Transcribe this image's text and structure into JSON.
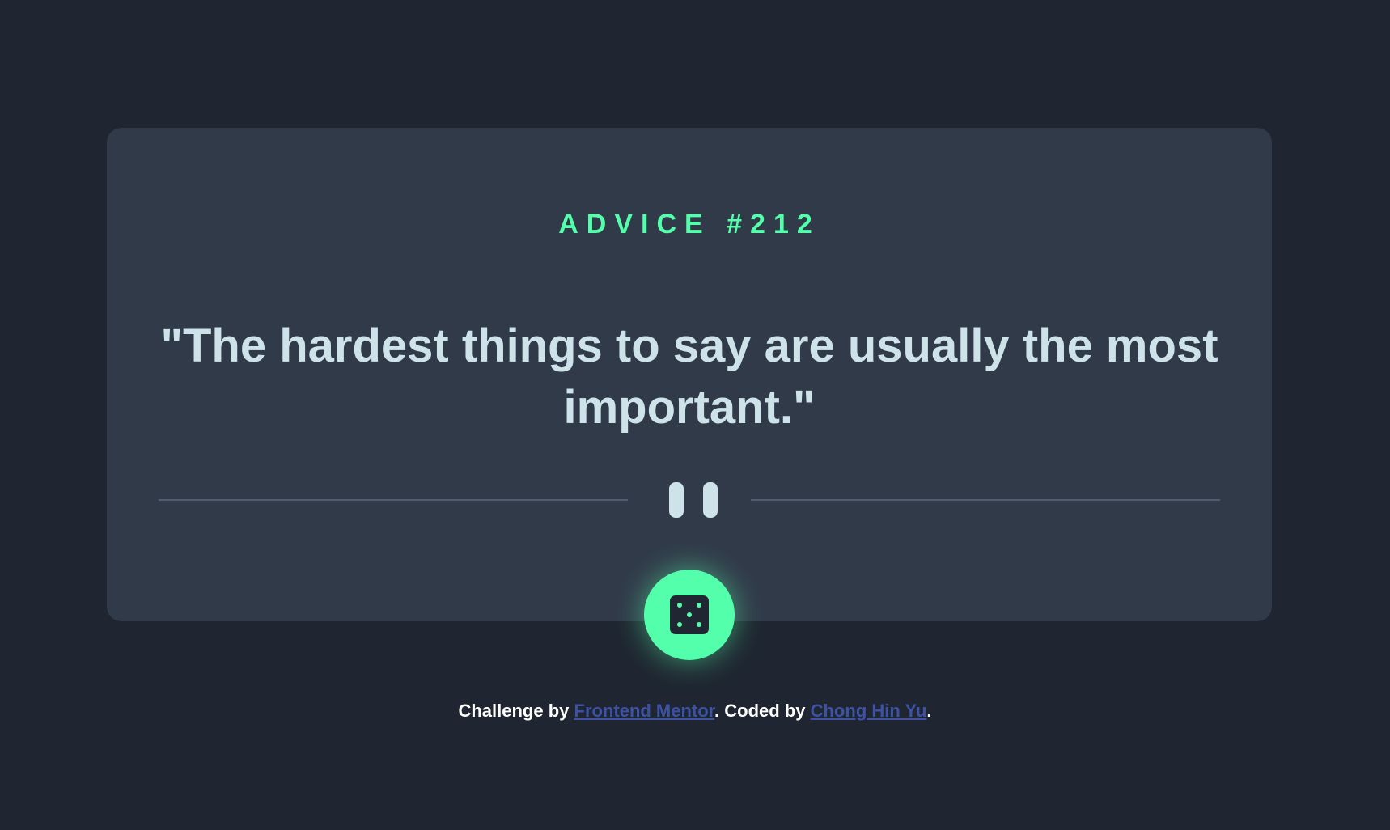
{
  "card": {
    "advice_id": "ADVICE #212",
    "quote": "\"The hardest things to say are usually the most important.\""
  },
  "divider": {
    "icon": "pause-icon"
  },
  "dice_button": {
    "icon": "dice-icon"
  },
  "footer": {
    "prefix": "Challenge by ",
    "link1": "Frontend Mentor",
    "middle": ". Coded by ",
    "link2": "Chong Hin Yu",
    "suffix": "."
  },
  "colors": {
    "background": "#1f2631",
    "card": "#313a49",
    "accent": "#53ffaa",
    "quote_text": "#cee3e9",
    "divider": "#4f5d74",
    "link": "#3e52a3"
  }
}
